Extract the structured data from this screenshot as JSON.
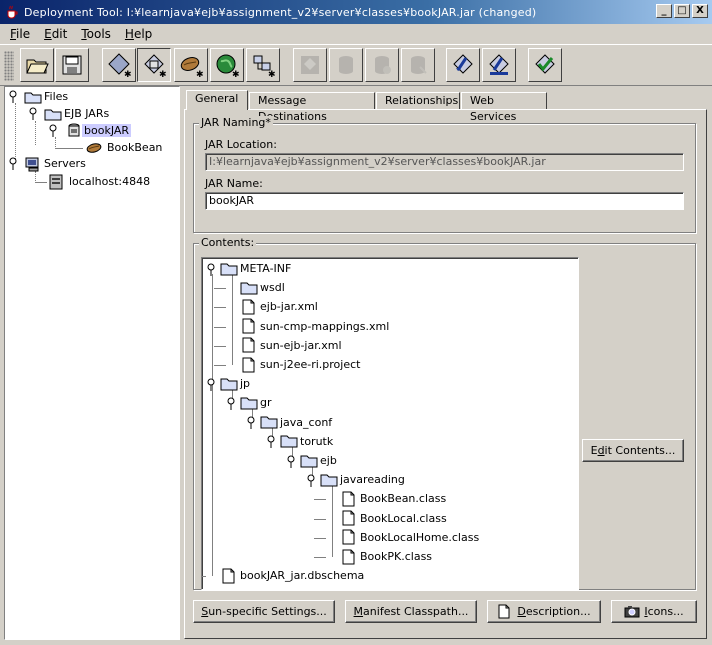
{
  "window": {
    "title": "Deployment Tool: I:¥learnjava¥ejb¥assignment_v2¥server¥classes¥bookJAR.jar (changed)",
    "buttons": [
      "_",
      "□",
      "X"
    ]
  },
  "menubar": {
    "items": [
      {
        "label": "File",
        "mnemonic": "F",
        "rest": "ile"
      },
      {
        "label": "Edit",
        "mnemonic": "E",
        "rest": "dit"
      },
      {
        "label": "Tools",
        "mnemonic": "T",
        "rest": "ools"
      },
      {
        "label": "Help",
        "mnemonic": "H",
        "rest": "elp"
      }
    ]
  },
  "toolbar": {
    "buttons": [
      {
        "icon": "open-folder-icon",
        "enabled": true
      },
      {
        "icon": "save-icon",
        "enabled": true
      },
      {
        "icon": "new-application-icon",
        "enabled": true
      },
      {
        "icon": "new-jar-icon",
        "enabled": true
      },
      {
        "icon": "new-bean-icon",
        "enabled": true
      },
      {
        "icon": "new-web-component-icon",
        "enabled": true
      },
      {
        "icon": "new-client-icon",
        "enabled": true
      },
      {
        "icon": "disabled-tool-1-icon",
        "enabled": false
      },
      {
        "icon": "disabled-tool-2-icon",
        "enabled": false
      },
      {
        "icon": "disabled-tool-3-icon",
        "enabled": false
      },
      {
        "icon": "disabled-tool-4-icon",
        "enabled": false
      },
      {
        "icon": "deploy-icon",
        "enabled": true
      },
      {
        "icon": "undeploy-icon",
        "enabled": true
      },
      {
        "icon": "verify-icon",
        "enabled": true
      }
    ]
  },
  "left_tree": {
    "nodes": [
      {
        "label": "Files"
      },
      {
        "label": "EJB JARs"
      },
      {
        "label": "bookJAR",
        "selected": true
      },
      {
        "label": "BookBean"
      },
      {
        "label": "Servers"
      },
      {
        "label": "localhost:4848"
      }
    ]
  },
  "tabs": [
    {
      "label": "General",
      "active": true
    },
    {
      "label": "Message Destinations",
      "active": false
    },
    {
      "label": "Relationships",
      "active": false
    },
    {
      "label": "Web Services",
      "active": false
    }
  ],
  "jar_naming": {
    "legend": "JAR Naming*",
    "location_label": "JAR Location:",
    "location_value": "I:¥learnjava¥ejb¥assignment_v2¥server¥classes¥bookJAR.jar",
    "name_label": "JAR Name:",
    "name_value": "bookJAR"
  },
  "contents": {
    "legend": "Contents:",
    "nodes": [
      {
        "label": "META-INF",
        "type": "folder"
      },
      {
        "label": "wsdl",
        "type": "folder"
      },
      {
        "label": "ejb-jar.xml",
        "type": "file"
      },
      {
        "label": "sun-cmp-mappings.xml",
        "type": "file"
      },
      {
        "label": "sun-ejb-jar.xml",
        "type": "file"
      },
      {
        "label": "sun-j2ee-ri.project",
        "type": "file"
      },
      {
        "label": "jp",
        "type": "folder"
      },
      {
        "label": "gr",
        "type": "folder"
      },
      {
        "label": "java_conf",
        "type": "folder"
      },
      {
        "label": "torutk",
        "type": "folder"
      },
      {
        "label": "ejb",
        "type": "folder"
      },
      {
        "label": "javareading",
        "type": "folder"
      },
      {
        "label": "BookBean.class",
        "type": "file"
      },
      {
        "label": "BookLocal.class",
        "type": "file"
      },
      {
        "label": "BookLocalHome.class",
        "type": "file"
      },
      {
        "label": "BookPK.class",
        "type": "file"
      },
      {
        "label": "bookJAR_jar.dbschema",
        "type": "file"
      }
    ],
    "edit_button": {
      "pre": "E",
      "mn": "d",
      "post": "it Contents..."
    }
  },
  "bottom_buttons": [
    {
      "pre": "",
      "mn": "S",
      "post": "un-specific Settings..."
    },
    {
      "pre": "",
      "mn": "M",
      "post": "anifest Classpath..."
    },
    {
      "pre": "",
      "mn": "D",
      "post": "escription...",
      "icon": "document-icon"
    },
    {
      "pre": "",
      "mn": "I",
      "post": "cons...",
      "icon": "camera-icon"
    }
  ],
  "colors": {
    "titlebar_start": "#0a246a",
    "titlebar_end": "#a6caf0",
    "selection": "#ccccff",
    "face": "#d4d0c8"
  }
}
